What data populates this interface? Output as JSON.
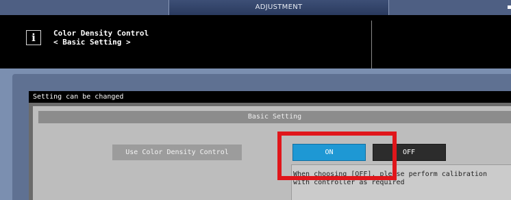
{
  "header_bar": {
    "title": "ADJUSTMENT"
  },
  "info": {
    "title": "Color Density Control",
    "subtitle": "< Basic Setting >"
  },
  "status": {
    "message": "Setting can be changed"
  },
  "section": {
    "title": "Basic Setting"
  },
  "setting": {
    "label": "Use Color Density Control",
    "on_label": "ON",
    "off_label": "OFF",
    "selected": "ON",
    "note": "When choosing [OFF], please perform calibration\nwith controller as required"
  },
  "colors": {
    "on_selected": "#1e98d4",
    "off_button": "#2c2c2c",
    "highlight_box": "#e0161b"
  }
}
